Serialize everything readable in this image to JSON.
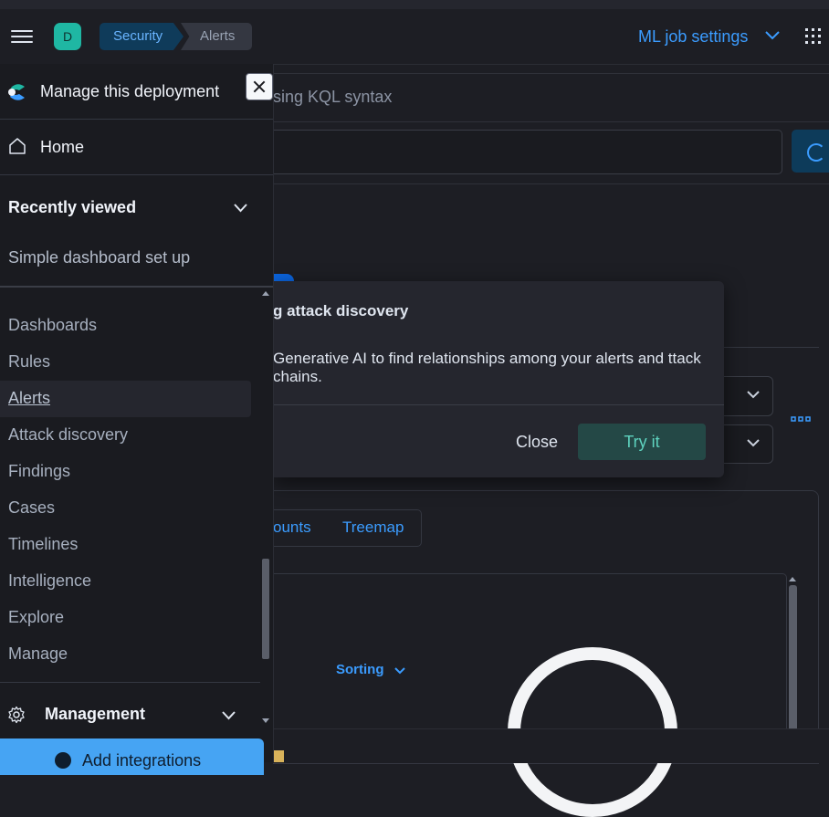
{
  "header": {
    "avatar_letter": "D",
    "breadcrumb": [
      "Security",
      "Alerts"
    ],
    "ml_job_settings": "ML job settings"
  },
  "search": {
    "kql_placeholder_partial": "sing KQL syntax"
  },
  "popover": {
    "title_partial": "g attack discovery",
    "body_partial": "Generative AI to find relationships among your alerts and ttack chains.",
    "close_label": "Close",
    "try_label": "Try it"
  },
  "main": {
    "tabs": [
      "ounts",
      "Treemap"
    ],
    "sorting_label": "Sorting"
  },
  "sidenav": {
    "manage_deployment": "Manage this deployment",
    "home": "Home",
    "recently_viewed": "Recently viewed",
    "recent_items": [
      "Simple dashboard set up"
    ],
    "items": [
      "Dashboards",
      "Rules",
      "Alerts",
      "Attack discovery",
      "Findings",
      "Cases",
      "Timelines",
      "Intelligence",
      "Explore",
      "Manage"
    ],
    "active_item": "Alerts",
    "management": "Management",
    "add_integrations": "Add integrations"
  },
  "colors": {
    "accent": "#3b9cff",
    "nav_bg": "#1a1b20",
    "page_bg": "#1d1e24",
    "try_button": "#244846",
    "add_button": "#46a4f3"
  }
}
